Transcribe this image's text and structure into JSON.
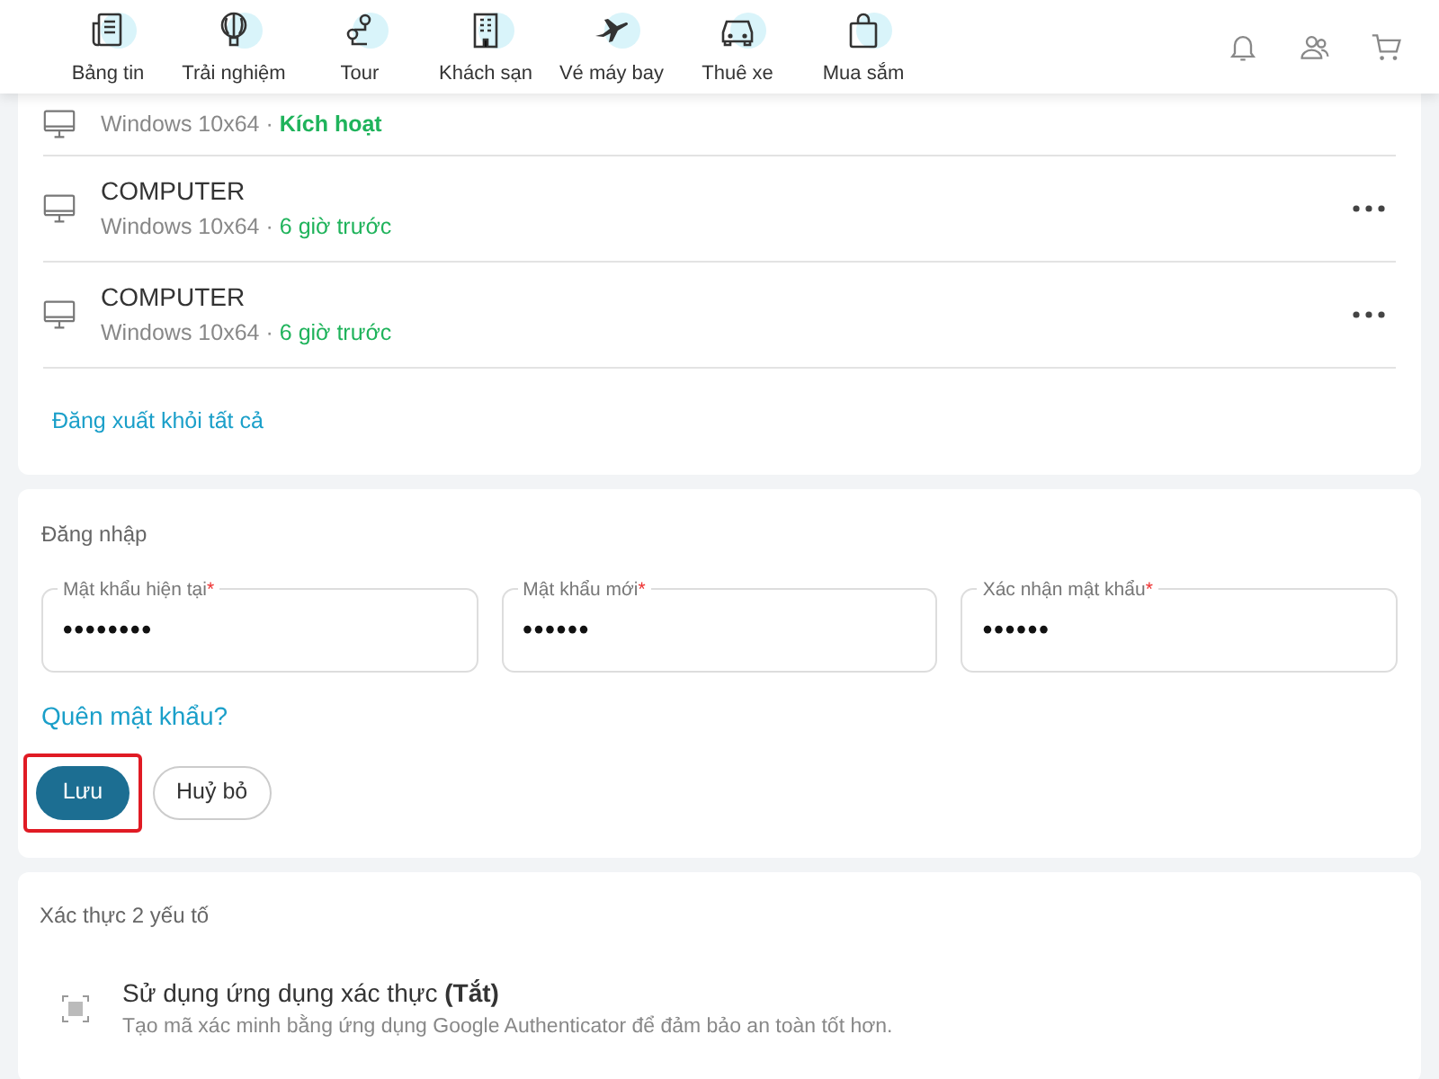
{
  "nav": {
    "items": [
      {
        "label": "Bảng tin",
        "kind": "news"
      },
      {
        "label": "Trải nghiệm",
        "kind": "balloon"
      },
      {
        "label": "Tour",
        "kind": "tour"
      },
      {
        "label": "Khách sạn",
        "kind": "hotel"
      },
      {
        "label": "Vé máy bay",
        "kind": "plane"
      },
      {
        "label": "Thuê xe",
        "kind": "car"
      },
      {
        "label": "Mua sắm",
        "kind": "bag"
      }
    ]
  },
  "devices": {
    "items": [
      {
        "os": "Windows 10x64",
        "separator": "·",
        "status": "Kích hoạt",
        "current": true
      },
      {
        "name": "COMPUTER",
        "os": "Windows 10x64",
        "separator": "·",
        "status": "6 giờ trước",
        "current": false
      },
      {
        "name": "COMPUTER",
        "os": "Windows 10x64",
        "separator": "·",
        "status": "6 giờ trước",
        "current": false
      }
    ],
    "logout_all": "Đăng xuất khỏi tất cả"
  },
  "login": {
    "title": "Đăng nhập",
    "fields": [
      {
        "label": "Mật khẩu hiện tại",
        "required_mark": "*",
        "value": "••••••••"
      },
      {
        "label": "Mật khẩu mới",
        "required_mark": "*",
        "value": "••••••"
      },
      {
        "label": "Xác nhận mật khẩu",
        "required_mark": "*",
        "value": "••••••"
      }
    ],
    "forgot": "Quên mật khẩu?",
    "save": {
      "label": "Lưu",
      "highlighted": true
    },
    "cancel": "Huỷ bỏ"
  },
  "two_factor": {
    "title": "Xác thực 2 yếu tố",
    "option": {
      "title": "Sử dụng ứng dụng xác thực **(Tắt)**",
      "description": "Tạo mã xác minh bằng ứng dụng Google Authenticator để đảm bảo an toàn tốt hơn."
    }
  }
}
